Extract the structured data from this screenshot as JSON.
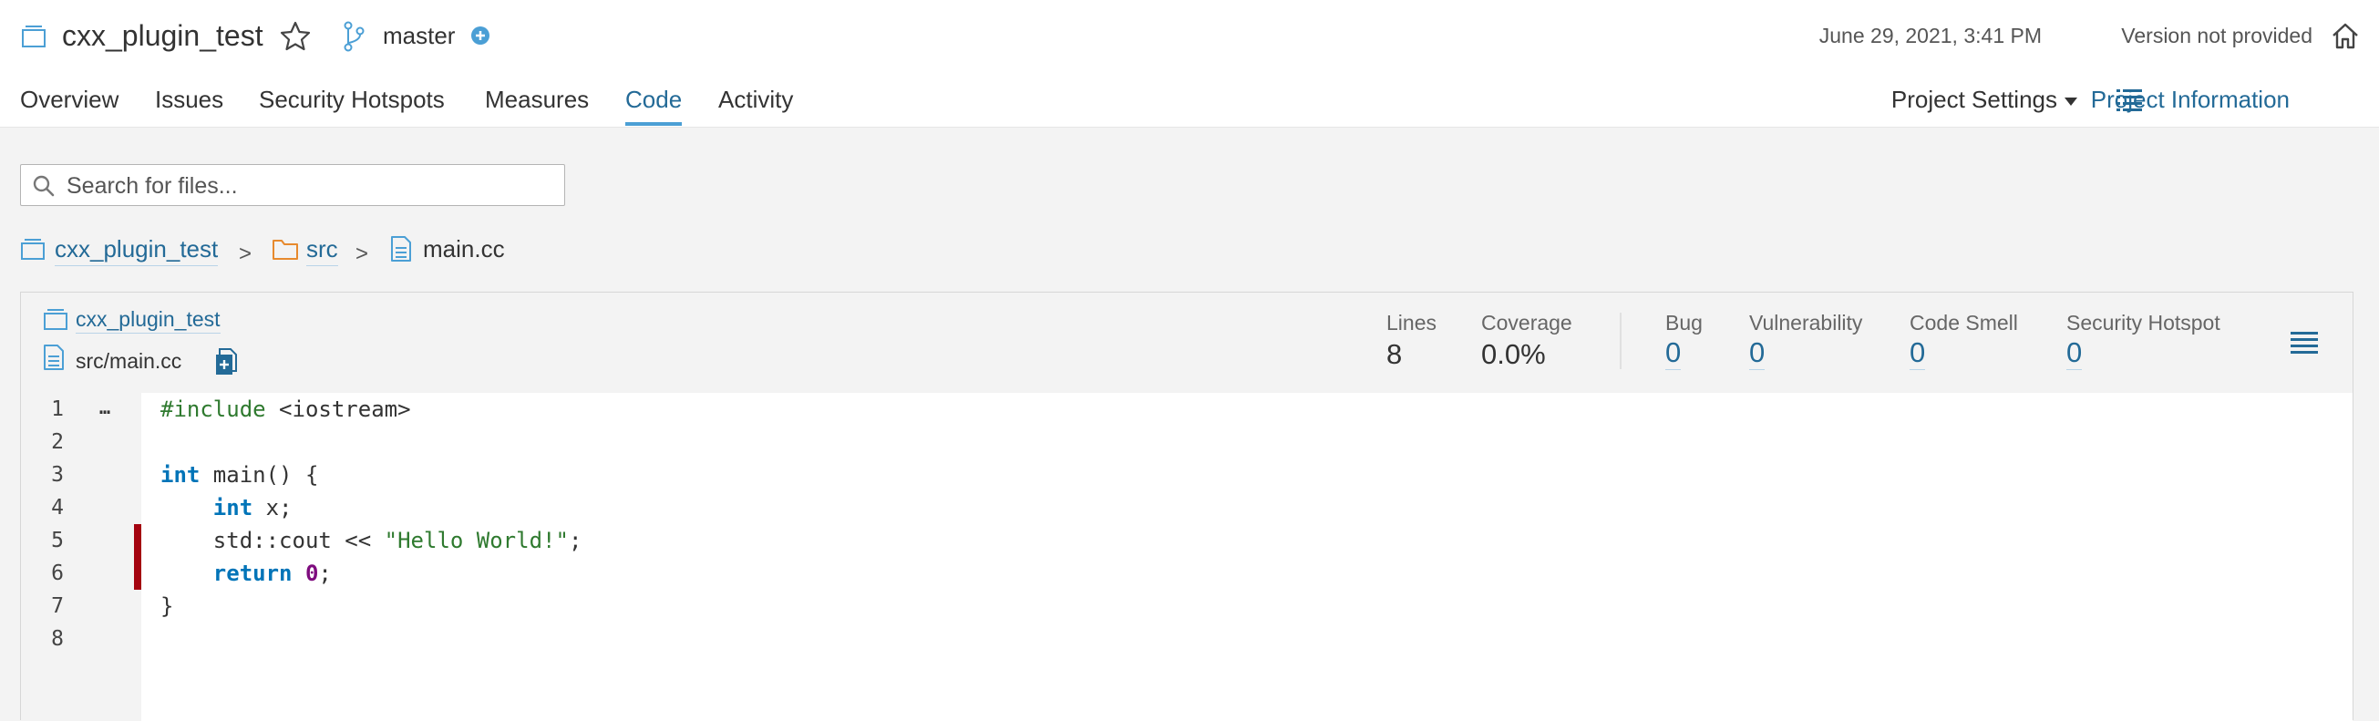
{
  "header": {
    "project_name": "cxx_plugin_test",
    "branch": "master",
    "date": "June 29, 2021, 3:41 PM",
    "version": "Version not provided"
  },
  "tabs": [
    {
      "label": "Overview"
    },
    {
      "label": "Issues"
    },
    {
      "label": "Security Hotspots"
    },
    {
      "label": "Measures"
    },
    {
      "label": "Code",
      "active": true
    },
    {
      "label": "Activity"
    }
  ],
  "right_nav": {
    "project_settings": "Project Settings",
    "project_information": "Project Information"
  },
  "search": {
    "placeholder": "Search for files...",
    "value": ""
  },
  "breadcrumbs": [
    {
      "label": "cxx_plugin_test",
      "icon": "project-icon"
    },
    {
      "label": "src",
      "icon": "folder-icon"
    },
    {
      "label": "main.cc",
      "icon": "file-icon"
    }
  ],
  "breadcrumb_separator": ">",
  "file_header": {
    "project": "cxx_plugin_test",
    "path": "src/main.cc"
  },
  "measures": [
    {
      "label": "Lines",
      "value": "8"
    },
    {
      "label": "Coverage",
      "value": "0.0%"
    },
    {
      "label": "Bug",
      "value": "0"
    },
    {
      "label": "Vulnerability",
      "value": "0"
    },
    {
      "label": "Code Smell",
      "value": "0"
    },
    {
      "label": "Security Hotspot",
      "value": "0"
    }
  ],
  "source": {
    "lines": [
      {
        "number": "1",
        "marker": "…"
      },
      {
        "number": "2"
      },
      {
        "number": "3"
      },
      {
        "number": "4"
      },
      {
        "number": "5",
        "uncovered": true
      },
      {
        "number": "6",
        "uncovered": true
      },
      {
        "number": "7"
      },
      {
        "number": "8"
      }
    ],
    "tokens": {
      "l1_pp": "#include",
      "l1_rest": " <iostream>",
      "l3_kw": "int",
      "l3_rest": " main() {",
      "l4_indent": "    ",
      "l4_kw": "int",
      "l4_rest": " x;",
      "l5_text": "    std::cout << ",
      "l5_str": "\"Hello World!\"",
      "l5_end": ";",
      "l6_indent": "    ",
      "l6_kw": "return",
      "l6_sp": " ",
      "l6_num": "0",
      "l6_end": ";",
      "l7_text": "}"
    }
  },
  "colors": {
    "link": "#236a97",
    "tab_active_underline": "#4b9fd5",
    "uncovered": "#a4030f",
    "keyword": "#0074b8",
    "string": "#2f7a2f"
  }
}
